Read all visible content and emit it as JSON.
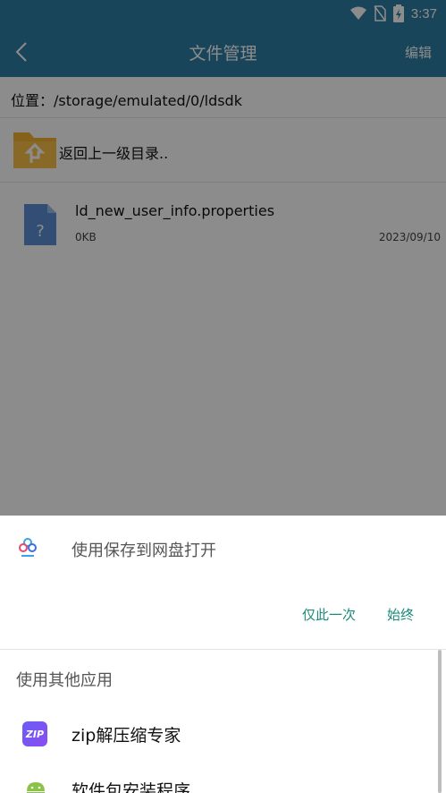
{
  "status_bar": {
    "time": "3:37",
    "icons": [
      "wifi-icon",
      "no-sim-icon",
      "battery-charging-icon"
    ]
  },
  "app_bar": {
    "title": "文件管理",
    "edit_label": "编辑",
    "back_icon": "back-arrow-icon"
  },
  "location": {
    "text": "位置：/storage/emulated/0/ldsdk"
  },
  "parent_dir": {
    "label": "返回上一级目录..",
    "icon": "folder-up-icon"
  },
  "files": [
    {
      "name": "ld_new_user_info.properties",
      "size": "0KB",
      "date": "2023/09/10",
      "icon": "unknown-file-icon"
    }
  ],
  "chooser": {
    "default_app_label": "使用保存到网盘打开",
    "default_app_icon": "cloud-disk-icon",
    "just_once_label": "仅此一次",
    "always_label": "始终",
    "other_apps_header": "使用其他应用",
    "apps": [
      {
        "label": "zip解压缩专家",
        "icon": "zip-app-icon",
        "icon_text": "ZIP"
      },
      {
        "label": "软件包安装程序",
        "icon": "android-icon"
      }
    ]
  },
  "colors": {
    "app_bar": "#2f7fa5",
    "accent_action": "#1a8a7a",
    "folder": "#f2b233",
    "file_icon": "#5b8fd6"
  }
}
